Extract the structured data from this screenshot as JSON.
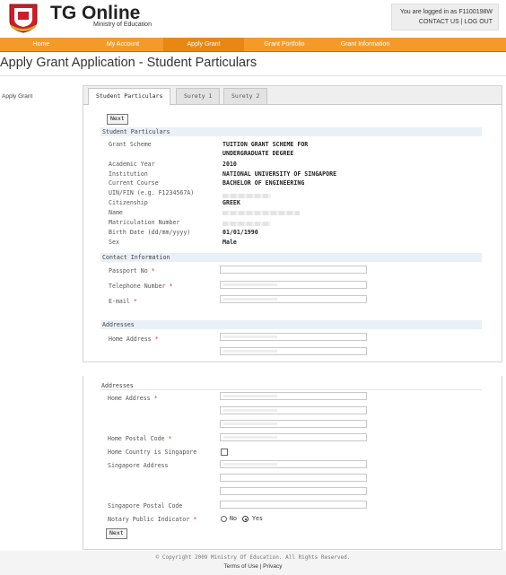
{
  "header": {
    "brand": "TG Online",
    "ministry": "Ministry of Education",
    "logged_in_as": "You are logged in as F1100198W",
    "contact_us": "CONTACT US",
    "separator": "|",
    "logout": "LOG OUT"
  },
  "nav": {
    "items": [
      "Home",
      "My Account",
      "Apply Grant",
      "Grant Portfolio",
      "Grant Information"
    ],
    "active": "Apply Grant",
    "color": "#f39a2a"
  },
  "page_title": "Apply Grant Application - Student Particulars",
  "sidebar": {
    "link": "Apply Grant"
  },
  "tabs": [
    "Student Particulars",
    "Surety 1",
    "Surety 2"
  ],
  "buttons": {
    "next": "Next"
  },
  "student_particulars": {
    "heading": "Student Particulars",
    "grant_scheme_label": "Grant Scheme",
    "grant_scheme_line1": "TUITION GRANT SCHEME FOR",
    "grant_scheme_line2": "UNDERGRADUATE DEGREE",
    "academic_year_label": "Academic Year",
    "academic_year": "2010",
    "institution_label": "Institution",
    "institution": "NATIONAL UNIVERSITY OF SINGAPORE",
    "course_label": "Current Course",
    "course": "BACHELOR OF ENGINEERING",
    "uin_label": "UIN/FIN (e.g. F1234567A)",
    "citizenship_label": "Citizenship",
    "citizenship": "GREEK",
    "name_label": "Name",
    "matric_label": "Matriculation Number",
    "dob_label": "Birth Date (dd/mm/yyyy)",
    "dob": "01/01/1990",
    "sex_label": "Sex",
    "sex": "Male"
  },
  "contact": {
    "heading": "Contact Information",
    "passport_label": "Passport No",
    "telephone_label": "Telephone Number",
    "email_label": "E-mail",
    "required_mark": "*"
  },
  "addresses": {
    "heading": "Addresses",
    "home_address_label": "Home Address",
    "home_postal_label": "Home Postal Code",
    "home_country_sg_label": "Home Country is Singapore",
    "sg_address_label": "Singapore Address",
    "sg_postal_label": "Singapore Postal Code",
    "notary_label": "Notary Public Indicator",
    "notary_no": "No",
    "notary_yes": "Yes",
    "notary_selected": "Yes"
  },
  "footer": {
    "copyright": "© Copyright 2009 Ministry Of Education. All Rights Reserved.",
    "terms": "Terms of Use",
    "separator": "|",
    "privacy": "Privacy"
  }
}
